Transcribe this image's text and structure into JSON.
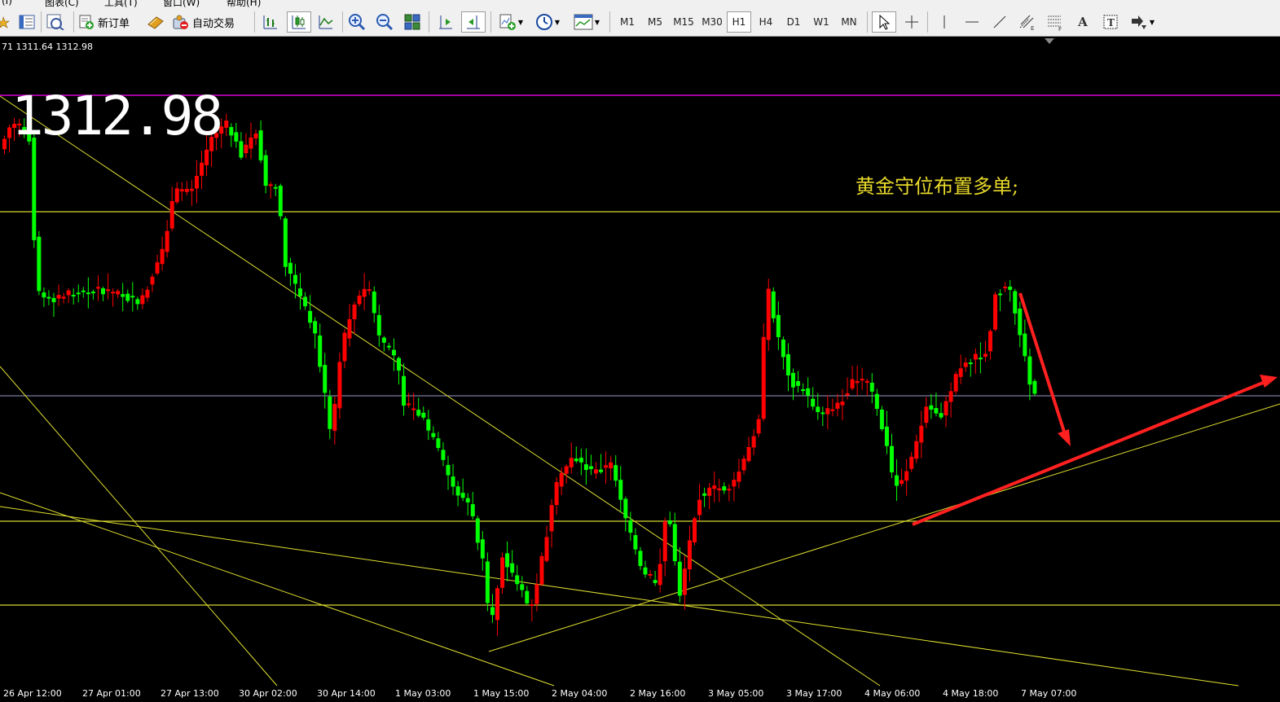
{
  "menu": {
    "items": [
      "(I)",
      "图表(C)",
      "工具(T)",
      "窗口(W)",
      "帮助(H)"
    ]
  },
  "toolbar": {
    "new_order_label": "新订单",
    "auto_trade_label": "自动交易",
    "timeframes": [
      "M1",
      "M5",
      "M15",
      "M30",
      "H1",
      "H4",
      "D1",
      "W1",
      "MN"
    ],
    "active_timeframe": "H1",
    "text_tool_label": "A"
  },
  "chart": {
    "ohlc_text": "71 1311.64 1312.98",
    "big_price": "1312.98",
    "annotation": "黄金守位布置多单;",
    "x_labels": [
      "26 Apr 12:00",
      "27 Apr 01:00",
      "27 Apr 13:00",
      "30 Apr 02:00",
      "30 Apr 14:00",
      "1 May 03:00",
      "1 May 15:00",
      "2 May 04:00",
      "2 May 16:00",
      "3 May 05:00",
      "3 May 17:00",
      "4 May 06:00",
      "4 May 18:00",
      "7 May 07:00"
    ],
    "colors": {
      "background": "#000000",
      "bull_candle": "#ff0000",
      "bear_candle": "#00ff00",
      "trendline": "#e8e840",
      "resistance_line": "#ff00ff",
      "bid_line": "#9a9ac8",
      "arrow": "#ff2020",
      "annotation": "#e8d92a"
    }
  },
  "chart_data": {
    "type": "candlestick",
    "x_labels": [
      "26 Apr 12:00",
      "27 Apr 01:00",
      "27 Apr 13:00",
      "30 Apr 02:00",
      "30 Apr 14:00",
      "1 May 03:00",
      "1 May 15:00",
      "2 May 04:00",
      "2 May 16:00",
      "3 May 05:00",
      "3 May 17:00",
      "4 May 06:00",
      "4 May 18:00",
      "7 May 07:00"
    ],
    "last_price": 1312.98,
    "ohlc_readout": "71 1311.64 1312.98",
    "annotation": "黄金守位布置多单;",
    "grid": false
  }
}
